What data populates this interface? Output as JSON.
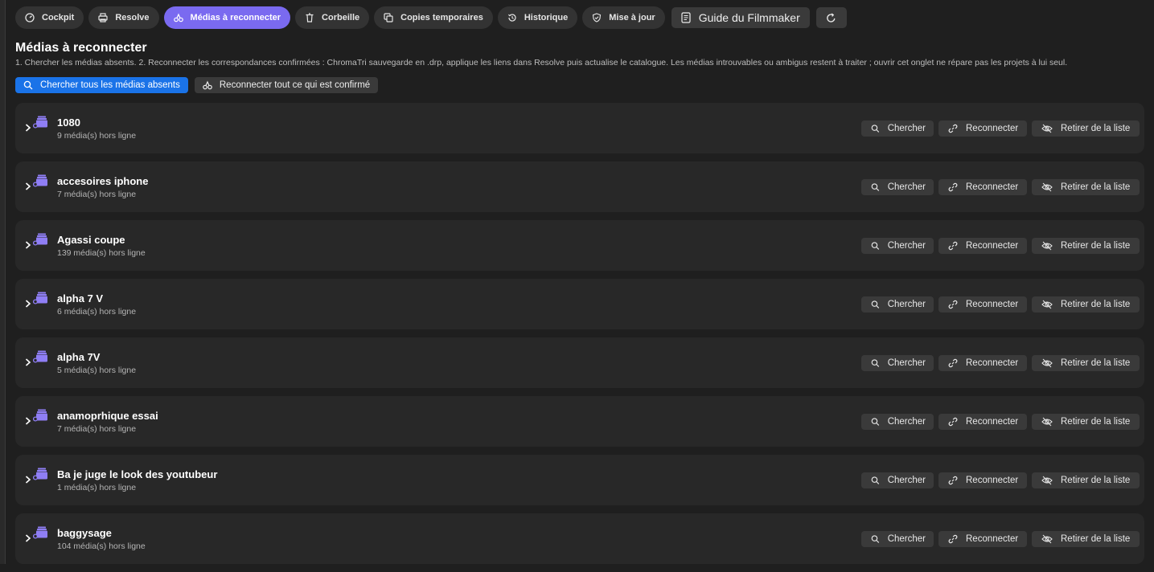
{
  "tabs": [
    {
      "label": "Cockpit",
      "icon": "gauge-icon"
    },
    {
      "label": "Resolve",
      "icon": "printer-icon"
    },
    {
      "label": "Médias à reconnecter",
      "icon": "reconnect-icon",
      "active": true
    },
    {
      "label": "Corbeille",
      "icon": "trash-icon"
    },
    {
      "label": "Copies temporaires",
      "icon": "copy-icon"
    },
    {
      "label": "Historique",
      "icon": "history-icon"
    },
    {
      "label": "Mise à jour",
      "icon": "shield-check-icon"
    }
  ],
  "toolbar": {
    "guide_label": "Guide du Filmmaker",
    "refresh_icon": "refresh-icon"
  },
  "page": {
    "title": "Médias à reconnecter",
    "description": "1. Chercher les médias absents. 2. Reconnecter les correspondances confirmées : ChromaTri sauvegarde en .drp, applique les liens dans Resolve puis actualise le catalogue. Les médias introuvables ou ambigus restent à traiter ; ouvrir cet onglet ne répare pas les projets à lui seul."
  },
  "actions": {
    "search_all": "Chercher tous les médias absents",
    "reconnect_all": "Reconnecter tout ce qui est confirmé"
  },
  "row_buttons": {
    "search": "Chercher",
    "reconnect": "Reconnecter",
    "remove": "Retirer de la liste"
  },
  "rows": [
    {
      "name": "1080",
      "count": "9 média(s) hors ligne"
    },
    {
      "name": "accesoires iphone",
      "count": "7 média(s) hors ligne"
    },
    {
      "name": "Agassi coupe",
      "count": "139 média(s) hors ligne"
    },
    {
      "name": "alpha 7 V",
      "count": "6 média(s) hors ligne"
    },
    {
      "name": "alpha 7V",
      "count": "5 média(s) hors ligne"
    },
    {
      "name": "anamoprhique essai",
      "count": "7 média(s) hors ligne"
    },
    {
      "name": "Ba je juge le look des youtubeur",
      "count": "1 média(s) hors ligne"
    },
    {
      "name": "baggysage",
      "count": "104 média(s) hors ligne"
    }
  ],
  "colors": {
    "accent": "#7a6af0",
    "primary_button": "#1a73e8",
    "folder_icon": "#8f7ef5"
  }
}
